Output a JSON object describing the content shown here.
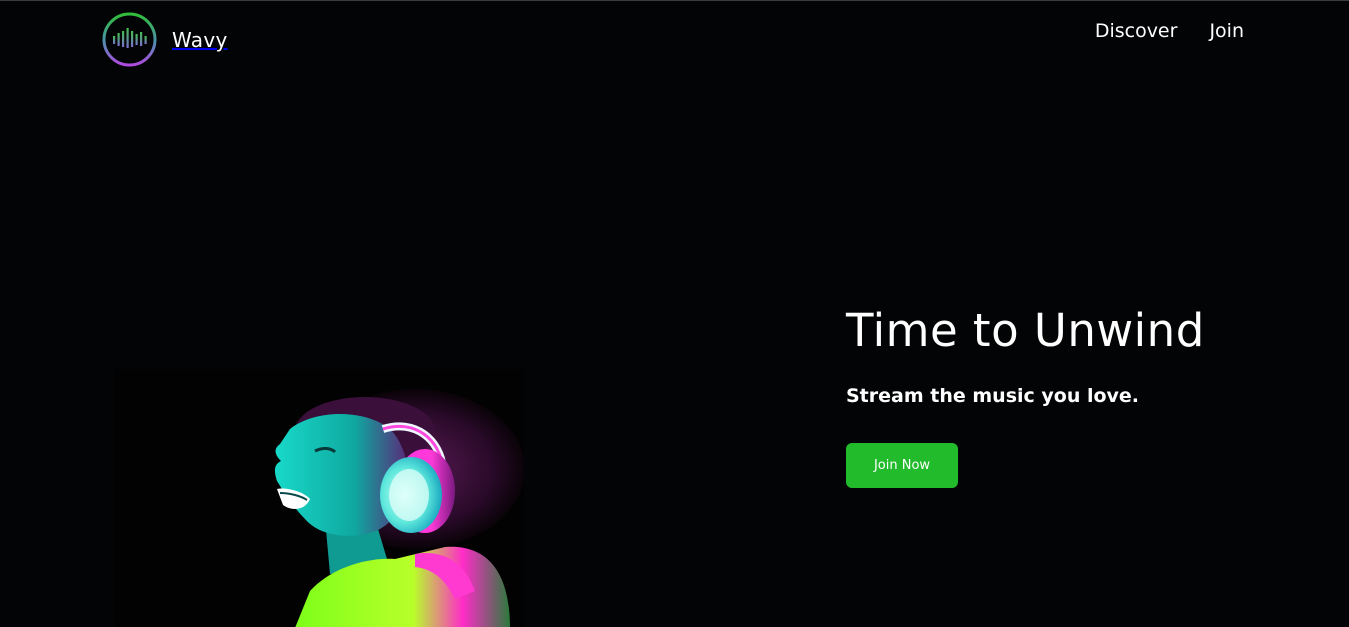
{
  "header": {
    "brand_name": "Wavy",
    "logo_icon": "sound-wave-circle-icon",
    "nav": [
      {
        "label": "Discover"
      },
      {
        "label": "Join"
      }
    ]
  },
  "hero": {
    "title": "Time to Unwind",
    "subtitle": "Stream the music you love.",
    "cta_label": "Join Now",
    "image_alt": "woman-with-headphones-photo"
  },
  "colors": {
    "background": "#030405",
    "accent_green": "#21bb2c",
    "logo_ring_top": "#2fbf3a",
    "logo_ring_bottom": "#a24bd6",
    "neon_teal": "#16d3c4",
    "neon_pink": "#ff1bd6",
    "neon_lime": "#8cff1a"
  }
}
